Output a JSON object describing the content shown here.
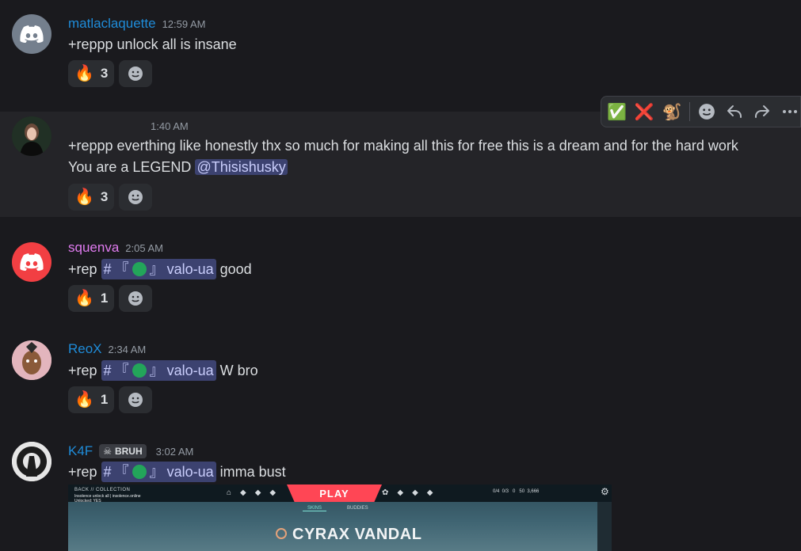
{
  "messages": [
    {
      "username": "matlaclaquette",
      "time": "12:59 AM",
      "text": "+reppp unlock all is insane",
      "reactions": [
        {
          "emoji": "🔥",
          "count": "3"
        }
      ]
    },
    {
      "username": "",
      "time": "1:40 AM",
      "lines": [
        "+reppp everthing like honestly thx so much for making  all this for free this is a dream and for the hard work",
        "You are a LEGEND "
      ],
      "mention": "@Thisishusky",
      "reactions": [
        {
          "emoji": "🔥",
          "count": "3"
        }
      ]
    },
    {
      "username": "squenva",
      "time": "2:05 AM",
      "prefix": "+rep",
      "channel": "valo-ua",
      "suffix": "good",
      "reactions": [
        {
          "emoji": "🔥",
          "count": "1"
        }
      ]
    },
    {
      "username": "ReoX",
      "time": "2:34 AM",
      "prefix": "+rep",
      "channel": "valo-ua",
      "suffix": "W bro",
      "reactions": [
        {
          "emoji": "🔥",
          "count": "1"
        }
      ]
    },
    {
      "username": "K4F",
      "tag": "BRUH",
      "time": "3:02 AM",
      "prefix": "+rep",
      "channel": "valo-ua",
      "suffix": "imma bust"
    }
  ],
  "channel_glyphs": {
    "hash": "#",
    "open": "『",
    "close": "』"
  },
  "hover_toolbar": {
    "check": "✅",
    "cross": "❌",
    "monkey": "🐒"
  },
  "screenshot": {
    "back": "BACK // COLLECTION",
    "line1": "Insolence unlock all | insolence.online",
    "line2": "Unlocked: YES",
    "play": "PLAY",
    "tab1": "SKINS",
    "tab2": "BUDDIES",
    "stats": "0/4  0/3   0   50  3,666",
    "weapon": "CYRAX VANDAL"
  },
  "colors": {
    "name_blue": "#1f8cd9",
    "name_pink": "#e07bf0",
    "discord_gray": "#747f8d",
    "discord_red": "#f23f43",
    "hover_bg": "#2b2d31"
  }
}
